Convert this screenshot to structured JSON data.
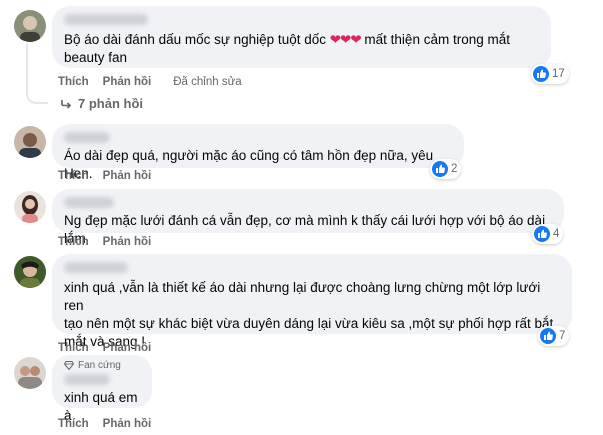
{
  "actions": {
    "like": "Thích",
    "reply": "Phản hồi",
    "edited": "Đã chỉnh sửa"
  },
  "comments": [
    {
      "text_before": "Bộ áo dài đánh dấu mốc sự nghiệp tuột dốc ",
      "hearts": "❤❤❤",
      "text_after": " mất thiện cảm trong mắt\nbeauty fan",
      "reactions": "17",
      "replies_label": "7 phản hồi"
    },
    {
      "text": "Áo dài đẹp quá, người mặc áo cũng có tâm hồn đẹp nữa, yêu Hen.",
      "reactions": "2"
    },
    {
      "text": "Ng đẹp mặc lưới đánh cá vẫn đẹp, cơ mà mình k thấy cái lưới hợp với bộ áo dài lắm",
      "reactions": "4"
    },
    {
      "text": "xinh quá ,vẫn là thiết kế áo dài nhưng lại được choàng lưng chừng một lớp lưới ren\ntạo nên một sự khác biệt vừa duyên dáng lại vừa kiêu sa ,một sự phối hợp rất bắt\nmắt và sang !",
      "reactions": "7"
    },
    {
      "badge": "Fan cứng",
      "text": "xinh quá em à"
    }
  ],
  "icons": {
    "like": "thumbs-up-icon",
    "replies": "reply-arrow-icon",
    "badge": "diamond-icon"
  },
  "colors": {
    "bubble": "#f0f2f5",
    "like_blue": "#1877f2",
    "meta_gray": "#65676b"
  }
}
